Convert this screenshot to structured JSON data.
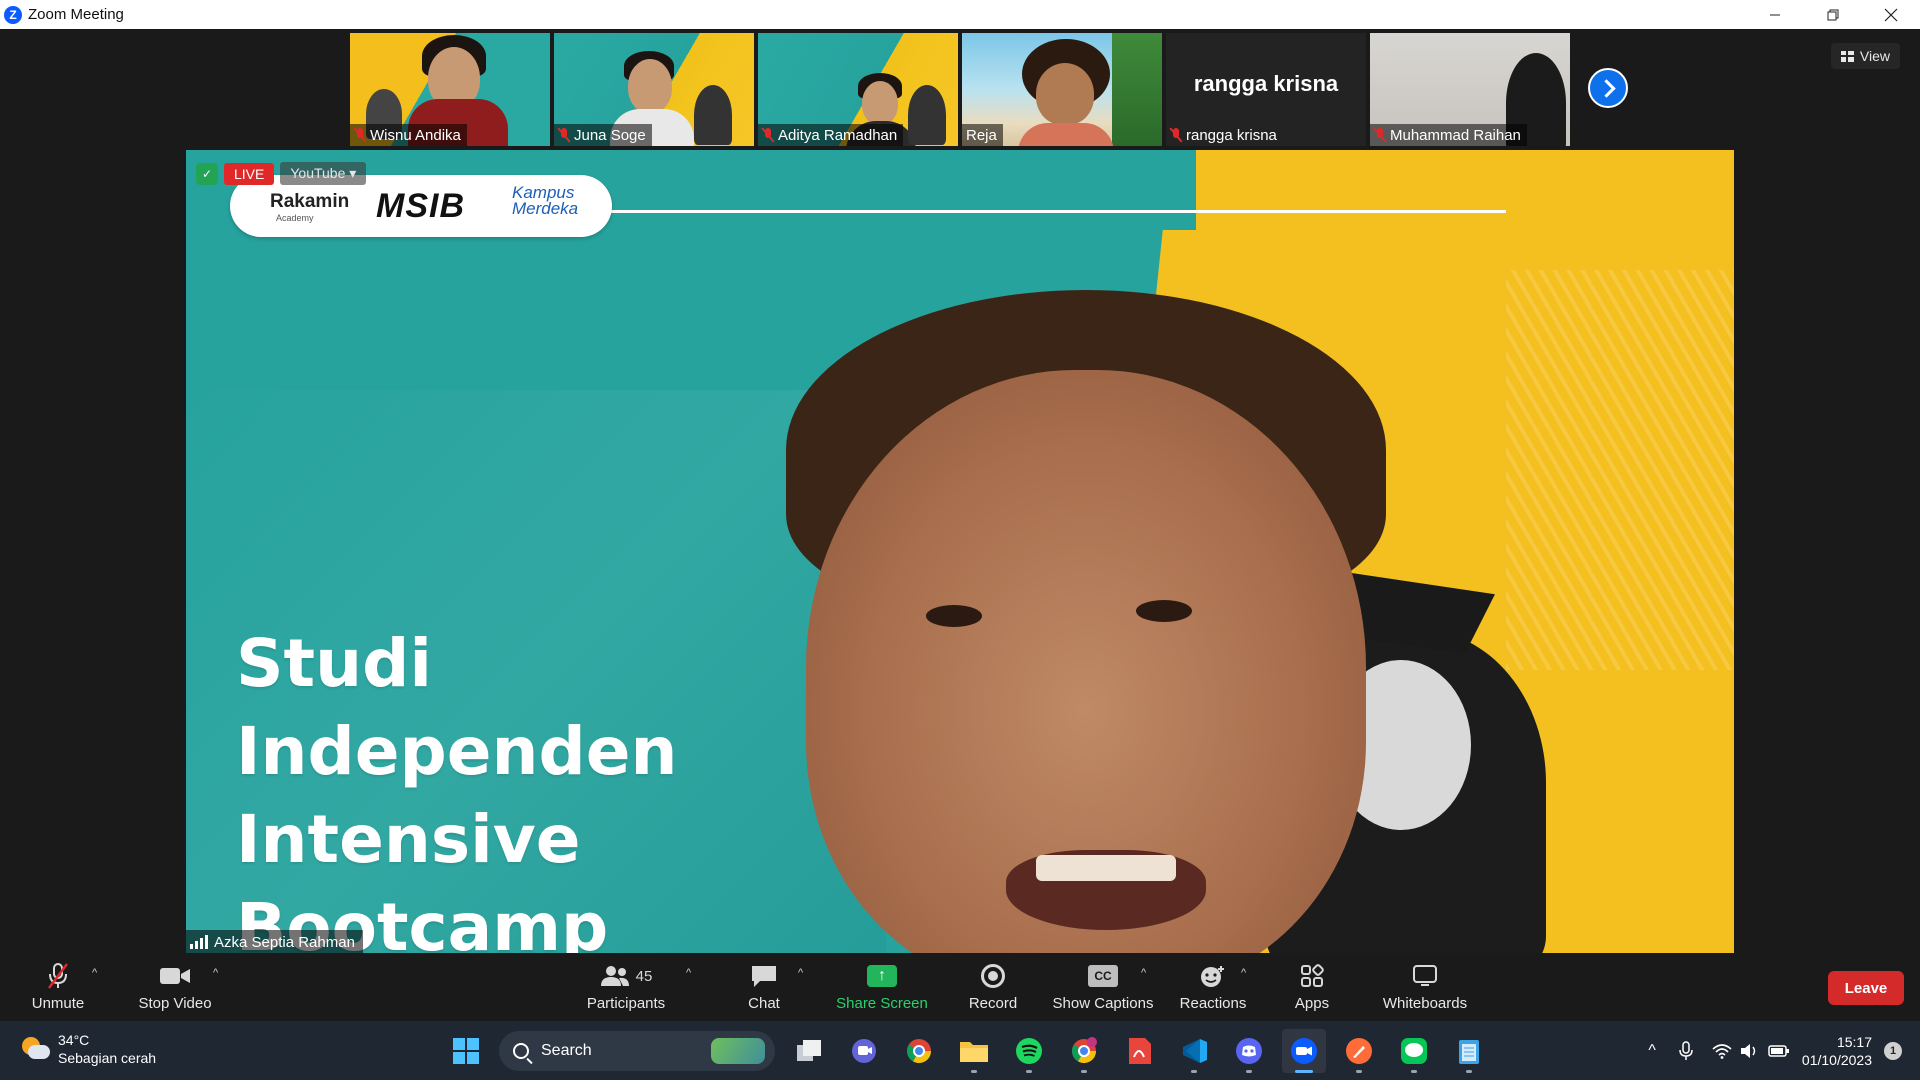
{
  "window": {
    "title": "Zoom Meeting"
  },
  "view_button": {
    "label": "View"
  },
  "thumbnails": [
    {
      "name": "Wisnu Andika",
      "muted": true
    },
    {
      "name": "Juna Soge",
      "muted": true
    },
    {
      "name": "Aditya Ramadhan",
      "muted": true
    },
    {
      "name": "Reja",
      "muted": false
    },
    {
      "name": "rangga krisna",
      "muted": true,
      "display_name": "rangga krisna"
    },
    {
      "name": "Muhammad Raihan",
      "muted": true
    }
  ],
  "main_video": {
    "live_label": "LIVE",
    "stream_label": "YouTube",
    "logo_rakamin": "Rakamin",
    "logo_rakamin_sub": "Academy",
    "logo_msib": "MSIB",
    "logo_km_1": "Kampus",
    "logo_km_2": "Merdeka",
    "title_line1": "Studi",
    "title_line2": "Independen",
    "title_line3": "Intensive",
    "title_line4": "Bootcamp",
    "speaker_name": "Azka Septia Rahman"
  },
  "toolbar": {
    "unmute": "Unmute",
    "stop_video": "Stop Video",
    "participants": "Participants",
    "participants_count": "45",
    "chat": "Chat",
    "share_screen": "Share Screen",
    "record": "Record",
    "show_captions": "Show Captions",
    "reactions": "Reactions",
    "apps": "Apps",
    "whiteboards": "Whiteboards",
    "leave": "Leave",
    "cc_icon_text": "CC"
  },
  "taskbar": {
    "temperature": "34°C",
    "weather": "Sebagian cerah",
    "search_placeholder": "Search",
    "time": "15:17",
    "date": "01/10/2023",
    "notification_count": "1"
  },
  "colors": {
    "zoom_blue": "#0b5cff",
    "leave_red": "#d42a2a",
    "share_green": "#23b55b",
    "teal_bg": "#27a39e",
    "yellow_bg": "#f4c01f"
  }
}
